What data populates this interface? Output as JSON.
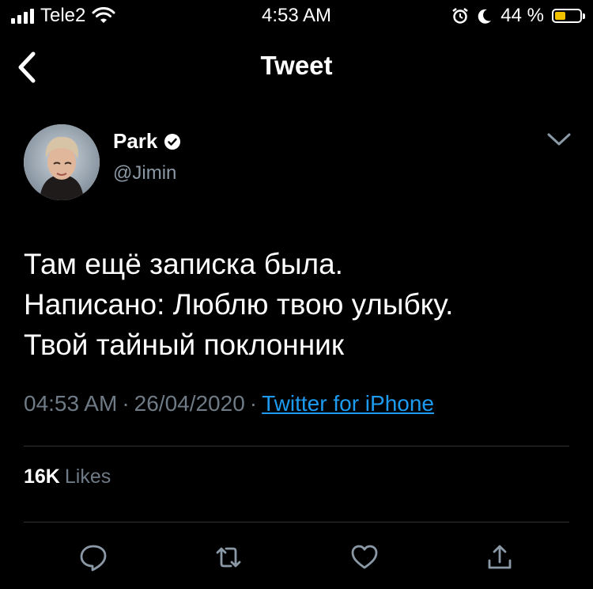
{
  "status_bar": {
    "carrier": "Tele2",
    "time": "4:53 AM",
    "battery_percent": "44 %",
    "battery_level": 0.44,
    "battery_color": "#f2c200"
  },
  "header": {
    "title": "Tweet",
    "back_icon": "chevron-left-icon"
  },
  "author": {
    "name": "Park",
    "handle": "@Jimin",
    "verified": true,
    "menu_icon": "chevron-down-icon"
  },
  "tweet": {
    "lines": [
      "Там ещё записка была.",
      "Написано: Люблю твою улыбку.",
      "Твой тайный поклонник"
    ],
    "time": "04:53 AM",
    "date": "26/04/2020",
    "source": "Twitter for iPhone"
  },
  "stats": {
    "likes_count": "16K",
    "likes_label": "Likes"
  },
  "actions": [
    "reply-icon",
    "retweet-icon",
    "like-icon",
    "share-icon"
  ],
  "colors": {
    "background": "#000000",
    "link": "#1d9bf0",
    "muted": "#6e7a85",
    "icon": "#8b98a5",
    "divider": "#2f3336"
  }
}
